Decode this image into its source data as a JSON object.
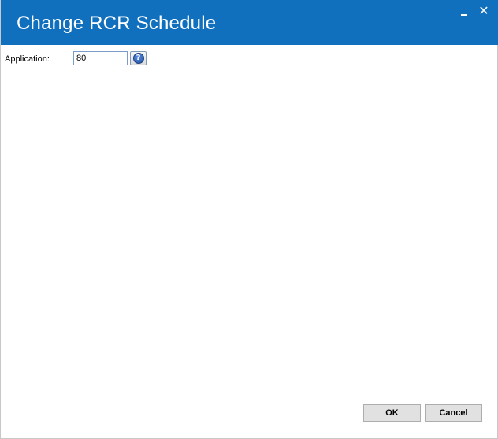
{
  "window": {
    "title": "Change RCR Schedule",
    "minimize_glyph": "_",
    "close_glyph": "✕"
  },
  "form": {
    "application_label": "Application:",
    "application_value": "80",
    "help_glyph": "?"
  },
  "footer": {
    "ok_label": "OK",
    "cancel_label": "Cancel"
  },
  "icons": {
    "minimize": "minimize-icon",
    "close": "close-icon",
    "help": "help-icon"
  },
  "colors": {
    "titlebar": "#1170be",
    "button_face": "#e1e1e1",
    "input_border": "#7a9cc9"
  }
}
